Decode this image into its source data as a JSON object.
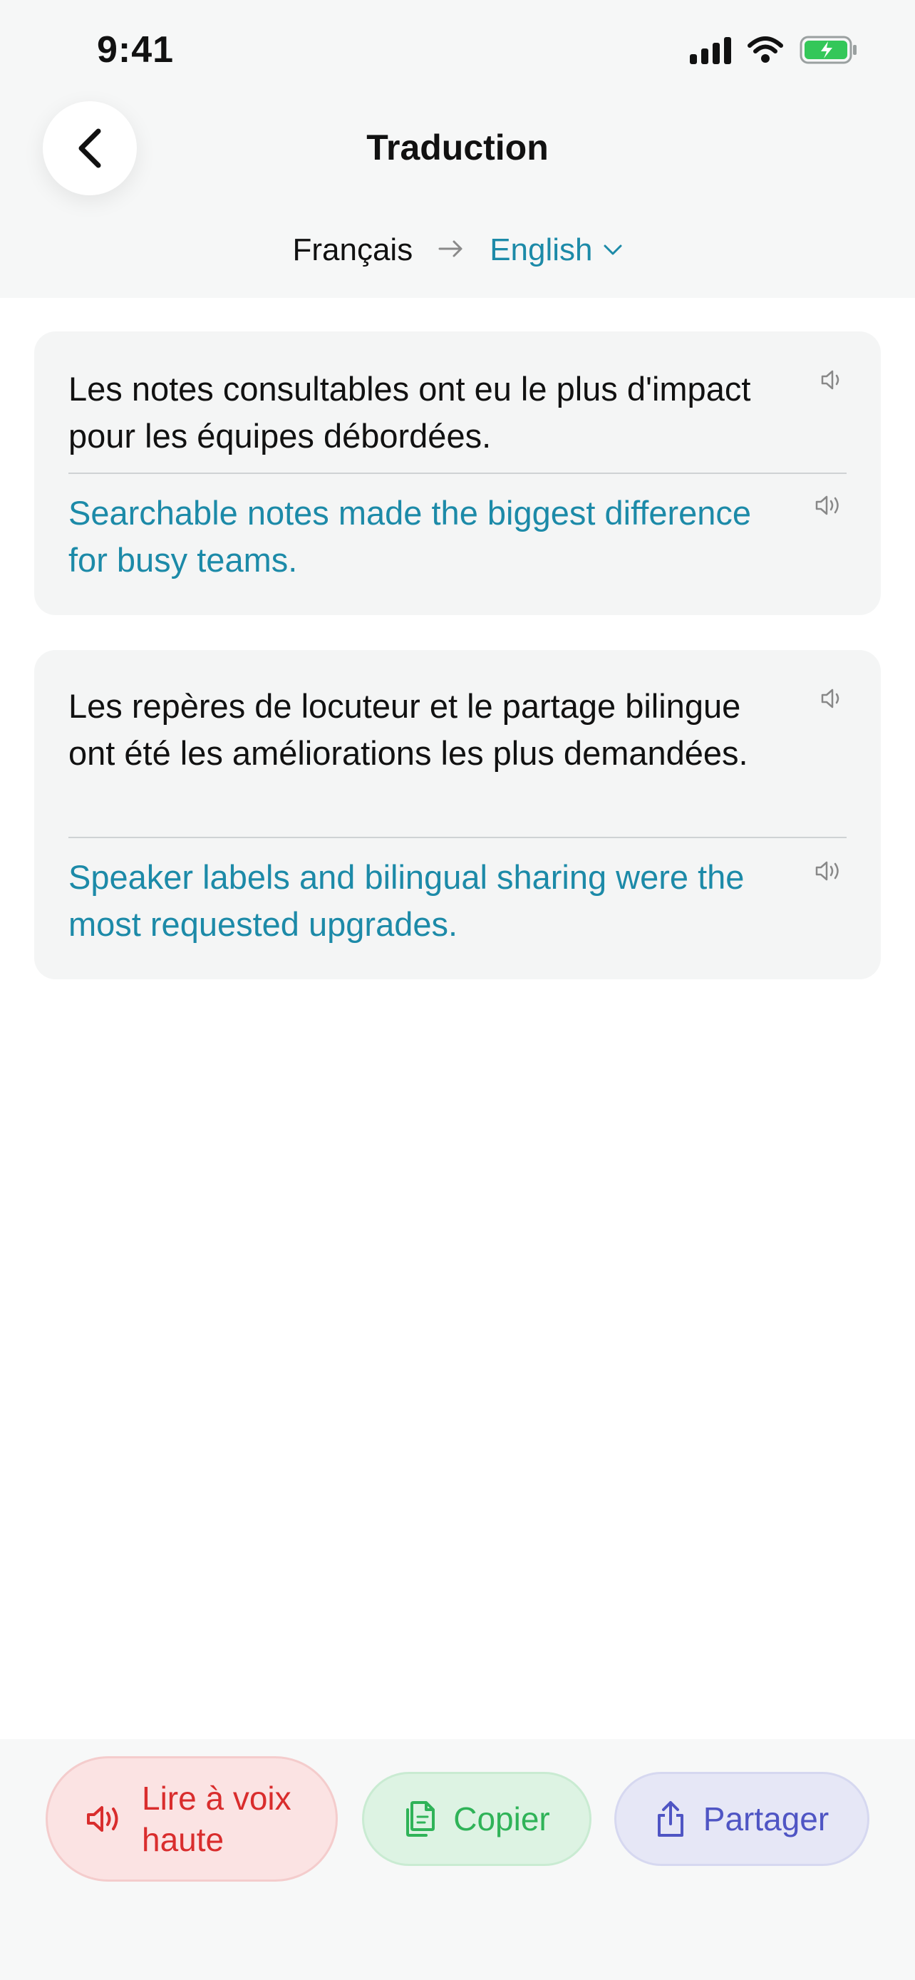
{
  "status_bar": {
    "time": "9:41"
  },
  "header": {
    "title": "Traduction",
    "source_language": "Français",
    "target_language": "English"
  },
  "translations": [
    {
      "source": "Les notes consultables ont eu le plus d'impact pour les équipes débordées.",
      "target": "Searchable notes made the biggest difference for busy teams."
    },
    {
      "source": "Les repères de locuteur et le partage bilingue ont été les améliorations les plus demandées.",
      "target": "Speaker labels and bilingual sharing were the most requested upgrades."
    }
  ],
  "actions": {
    "read_aloud": "Lire à voix haute",
    "copy": "Copier",
    "share": "Partager"
  },
  "colors": {
    "accent": "#1c8aa8",
    "read_aloud": "#d92d2d",
    "copy": "#2fb358",
    "share": "#4f55c4",
    "battery": "#34c759"
  },
  "icons": [
    "back-chevron-icon",
    "arrow-right-icon",
    "chevron-down-icon",
    "speaker-icon",
    "copy-icon",
    "share-icon",
    "signal-icon",
    "wifi-icon",
    "battery-icon"
  ]
}
